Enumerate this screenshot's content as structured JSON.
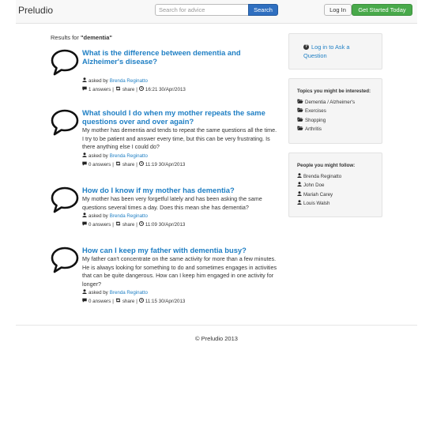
{
  "navbar": {
    "brand": "Preludio",
    "search_placeholder": "Search for advice",
    "search_button": "Search",
    "login_button": "Log In",
    "get_started_button": "Get Started Today"
  },
  "results": {
    "prefix": "Results for ",
    "query": "\"dementia\""
  },
  "questions": [
    {
      "title": "What is the difference between dementia and Alzheimer's disease?",
      "body": "",
      "asked_by_label": "asked by",
      "author": "Brenda Reginatto",
      "answers": "1 answers",
      "share": "share",
      "timestamp": "16:21 30/Apr/2013"
    },
    {
      "title": "What should I do when my mother repeats the same questions over and over again?",
      "body": "My mother has dementia and tends to repeat the same questions all the time. I try to be patient and answer every time, but this can be very frustrating. Is there anything else I could do?",
      "asked_by_label": "asked by",
      "author": "Brenda Reginatto",
      "answers": "0 answers",
      "share": "share",
      "timestamp": "11:19 30/Apr/2013"
    },
    {
      "title": "How do I know if my mother has dementia?",
      "body": "My mother has been very forgetful lately and has been asking the same questions several times a day. Does this mean she has dementia?",
      "asked_by_label": "asked by",
      "author": "Brenda Reginatto",
      "answers": "0 answers",
      "share": "share",
      "timestamp": "11:09 30/Apr/2013"
    },
    {
      "title": "How can I keep my father with dementia busy?",
      "body": "My father can't concentrate on the same activity for more than a few minutes. He is always looking for something to do and sometimes engages in activities that can be quite dangerous. How can I keep him engaged in one activity for longer?",
      "asked_by_label": "asked by",
      "author": "Brenda Reginatto",
      "answers": "0 answers",
      "share": "share",
      "timestamp": "11:15 30/Apr/2013"
    }
  ],
  "sidebar": {
    "ask_link": "Log in to Ask a Question",
    "topics_title": "Topics you might be interested:",
    "topics": [
      "Dementia / Alzheimer's",
      "Exercises",
      "Shopping",
      "Arthritis"
    ],
    "people_title": "People you might follow:",
    "people": [
      "Brenda Reginatto",
      "John Doe",
      "Mariah Carey",
      "Louis Walsh"
    ]
  },
  "footer": {
    "copyright": "© Preludio 2013"
  },
  "icons": {
    "question": "speech-bubble-icon",
    "user": "user-icon",
    "comment": "comment-icon",
    "share": "retweet-icon",
    "clock": "clock-icon",
    "folder": "folder-open-icon",
    "ask": "question-circle-icon"
  },
  "colors": {
    "link": "#1f7fc4",
    "search_button": "#2f6fc0",
    "get_started_button": "#48a94a",
    "navbar_bg": "#f8f8f8",
    "panel_bg": "#f5f5f5"
  }
}
